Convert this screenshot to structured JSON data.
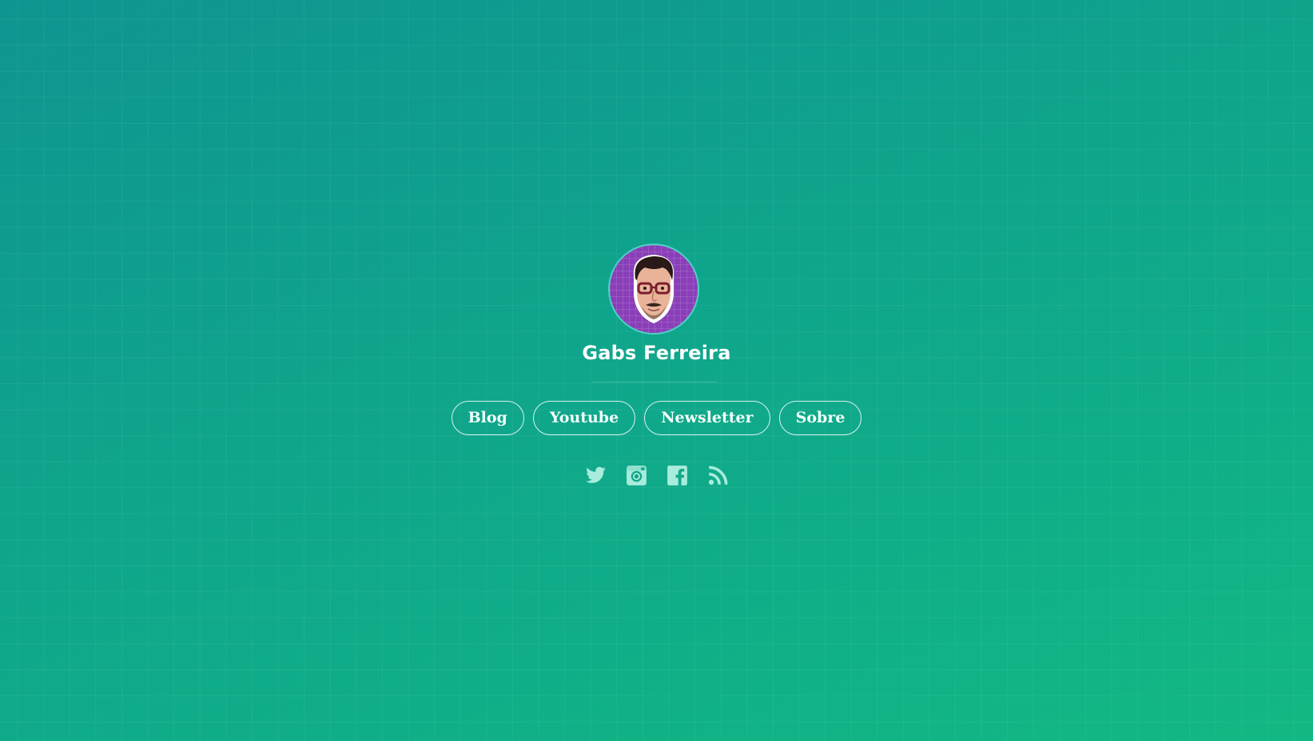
{
  "profile": {
    "name": "Gabs Ferreira",
    "avatar_icon": "avatar-photo",
    "avatar_background": "#8a3fb8"
  },
  "nav": {
    "items": [
      {
        "label": "Blog"
      },
      {
        "label": "Youtube"
      },
      {
        "label": "Newsletter"
      },
      {
        "label": "Sobre"
      }
    ]
  },
  "social": {
    "icons": [
      "twitter-icon",
      "instagram-icon",
      "facebook-icon",
      "rss-icon"
    ],
    "icon_color": "#a8ecdd"
  },
  "theme": {
    "background_start": "#0f9590",
    "background_end": "#12b883",
    "text_color": "#ffffff"
  }
}
